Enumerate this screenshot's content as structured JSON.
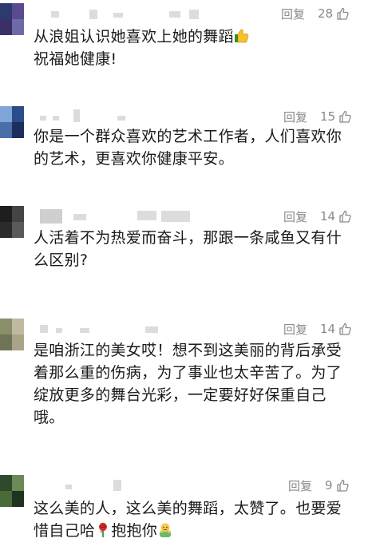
{
  "comments": [
    {
      "reply_label": "回复",
      "likes": "28",
      "text_line1": "从浪姐认识她喜欢上她的舞蹈",
      "emoji_line1": "thumbs-up",
      "text_line2": "祝福她健康!"
    },
    {
      "reply_label": "回复",
      "likes": "15",
      "text_line1": "你是一个群众喜欢的艺术工作者，人们喜欢你",
      "text_line2": "的艺术，更喜欢你健康平安。"
    },
    {
      "reply_label": "回复",
      "likes": "14",
      "text_line1": "人活着不为热爱而奋斗，那跟一条咸鱼又有什",
      "text_line2": "么区别?"
    },
    {
      "reply_label": "回复",
      "likes": "14",
      "text_line1": "是咱浙江的美女哎！想不到这美丽的背后承受",
      "text_line2": "着那么重的伤病，为了事业也太辛苦了。为了",
      "text_line3": "绽放更多的舞台光彩，一定要好好保重自己",
      "text_line4": "哦。"
    },
    {
      "reply_label": "回复",
      "likes": "9",
      "text_line1": "这么美的人，这么美的舞蹈，太赞了。也要爱",
      "text_line2a": "惜自己哈",
      "emoji_a": "rose",
      "text_line2b": "抱抱你",
      "emoji_b": "hug"
    }
  ],
  "colors": {
    "meta_gray": "#8a8a8a",
    "text": "#1a1a1a",
    "background": "#ffffff"
  },
  "icons": {
    "like": "thumbs-up-outline-icon"
  }
}
